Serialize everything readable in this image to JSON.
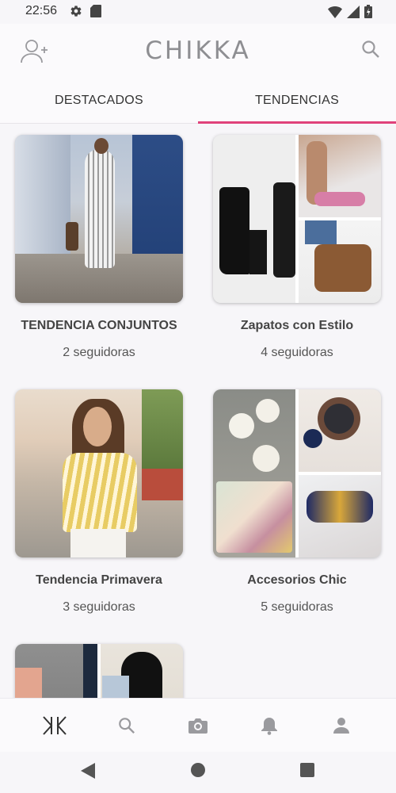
{
  "status_bar": {
    "time": "22:56"
  },
  "header": {
    "logo": "CHIKKA"
  },
  "tabs": [
    {
      "label": "DESTACADOS",
      "active": false
    },
    {
      "label": "TENDENCIAS",
      "active": true
    }
  ],
  "collections": [
    {
      "title": "TENDENCIA CONJUNTOS",
      "followers": "2 seguidoras"
    },
    {
      "title": "Zapatos con Estilo",
      "followers": "4 seguidoras"
    },
    {
      "title": "Tendencia Primavera",
      "followers": "3 seguidoras"
    },
    {
      "title": "Accesorios Chic",
      "followers": "5 seguidoras"
    }
  ],
  "colors": {
    "accent": "#e0427a",
    "icon_gray": "#9a9a9e",
    "active_icon": "#333333"
  },
  "bottom_nav": [
    "chikka-logo-icon",
    "search-icon",
    "camera-icon",
    "bell-icon",
    "profile-icon"
  ]
}
